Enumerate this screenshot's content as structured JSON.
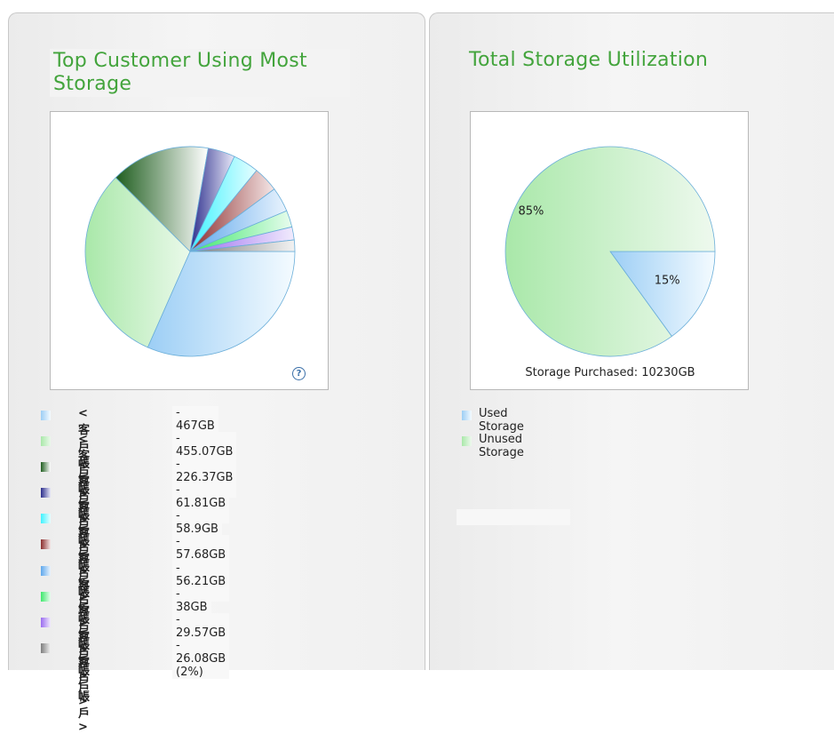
{
  "left_panel": {
    "title": "Top Customer Using Most Storage",
    "help_icon": "question-circle-icon"
  },
  "right_panel": {
    "title": "Total Storage Utilization",
    "storage_note": "Storage Purchased: 10230GB"
  },
  "chart_data": [
    {
      "type": "pie",
      "title": "Top Customer Using Most Storage",
      "slices": [
        {
          "label": "<客戶帳戶>",
          "text": " - 467GB (30%)",
          "value": 467,
          "percent": 30,
          "color": "#9ccef5",
          "color2": "#f4fbff"
        },
        {
          "label": "<客戶帳戶>",
          "text": " - 455.07GB (29%)",
          "value": 455.07,
          "percent": 29,
          "color": "#a9e8a9",
          "color2": "#eaf9ea"
        },
        {
          "label": "<客戶帳戶>",
          "text": " - 226.37GB (15%)",
          "value": 226.37,
          "percent": 15,
          "color": "#1f5e1f",
          "color2": "#ffffff"
        },
        {
          "label": "<客戶帳戶>",
          "text": " - 61.81GB (4%)",
          "value": 61.81,
          "percent": 4,
          "color": "#2c2e8c",
          "color2": "#e8e8f8"
        },
        {
          "label": "<客戶帳戶>",
          "text": " - 58.9GB (4%)",
          "value": 58.9,
          "percent": 4,
          "color": "#3ef2ff",
          "color2": "#e6feff"
        },
        {
          "label": "<客戶帳戶>",
          "text": " - 57.68GB (4%)",
          "value": 57.68,
          "percent": 4,
          "color": "#8c2d2d",
          "color2": "#f4e6e6"
        },
        {
          "label": "<客戶帳戶>",
          "text": " - 56.21GB (4%)",
          "value": 56.21,
          "percent": 4,
          "color": "#5fa8ec",
          "color2": "#e9f3fd"
        },
        {
          "label": "<客戶帳戶>",
          "text": " - 38GB (2%)",
          "value": 38,
          "percent": 2,
          "color": "#3ee86c",
          "color2": "#e8fcee"
        },
        {
          "label": "<客戶帳戶>",
          "text": " - 29.57GB (2%)",
          "value": 29.57,
          "percent": 2,
          "color": "#9b6cf0",
          "color2": "#f1ebfd"
        },
        {
          "label": "<客戶帳戶>",
          "text": " - 26.08GB (2%)",
          "value": 26.08,
          "percent": 2,
          "color": "#7e7e7e",
          "color2": "#f2f2f2"
        }
      ]
    },
    {
      "type": "pie",
      "title": "Total Storage Utilization",
      "slices": [
        {
          "label": "Used Storage",
          "value": 15,
          "percent_label": "15%",
          "color": "#9ccef5",
          "color2": "#f4fbff"
        },
        {
          "label": "Unused Storage",
          "value": 85,
          "percent_label": "85%",
          "color": "#a9e8a9",
          "color2": "#eef9ee"
        }
      ]
    }
  ]
}
